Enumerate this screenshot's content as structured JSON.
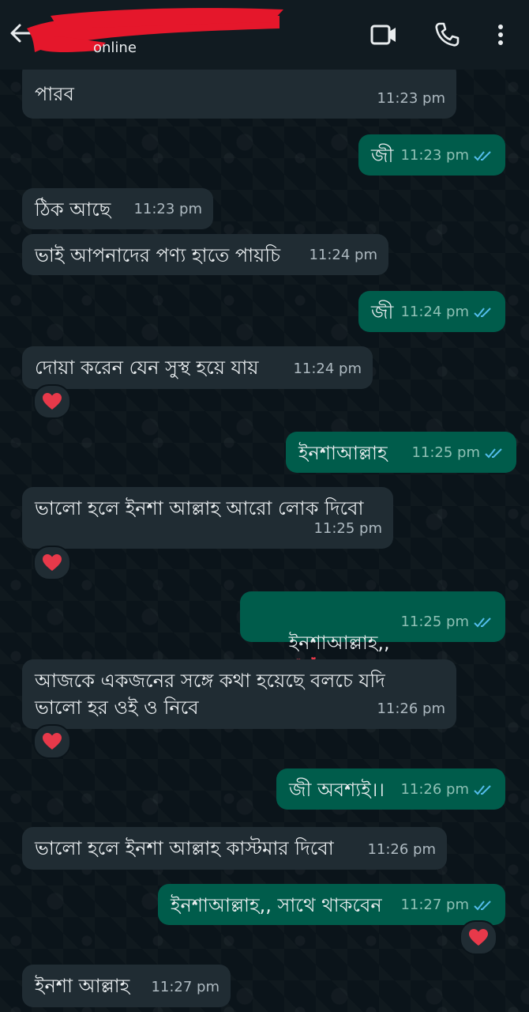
{
  "header": {
    "status": "online"
  },
  "messages": [
    {
      "id": "m0",
      "dir": "in",
      "text": "পারব",
      "time": "11:23 pm"
    },
    {
      "id": "m1",
      "dir": "out",
      "text": "জী",
      "time": "11:23 pm"
    },
    {
      "id": "m2",
      "dir": "in",
      "text": "ঠিক আছে",
      "time": "11:23 pm"
    },
    {
      "id": "m3",
      "dir": "in",
      "text": "ভাই আপনাদের পণ্য হাতে পায়চি",
      "time": "11:24 pm"
    },
    {
      "id": "m4",
      "dir": "out",
      "text": "জী",
      "time": "11:24 pm"
    },
    {
      "id": "m5",
      "dir": "in",
      "text": "দোয়া করেন যেন সুস্থ হয়ে যায়",
      "time": "11:24 pm",
      "reaction": "heart"
    },
    {
      "id": "m6",
      "dir": "out",
      "text": "ইনশাআল্লাহ",
      "time": "11:25 pm"
    },
    {
      "id": "m7",
      "dir": "in",
      "text": "ভালো হলে ইনশা আল্লাহ আরো লোক দিবো",
      "time": "11:25 pm",
      "reaction": "heart"
    },
    {
      "id": "m8",
      "dir": "out",
      "text": "ইনশাআল্লাহ,,",
      "time": "11:25 pm",
      "emoji": "smiling-face-with-hearts"
    },
    {
      "id": "m9",
      "dir": "in",
      "text": "আজকে একজনের সঙ্গে কথা হয়েছে বলচে যদি\nভালো হর ওই ও নিবে",
      "time": "11:26 pm",
      "reaction": "heart"
    },
    {
      "id": "m10",
      "dir": "out",
      "text": "জী অবশ্যই।।",
      "time": "11:26 pm"
    },
    {
      "id": "m11",
      "dir": "in",
      "text": "ভালো হলে ইনশা আল্লাহ কাস্টমার দিবো",
      "time": "11:26 pm"
    },
    {
      "id": "m12",
      "dir": "out",
      "text": "ইনশাআল্লাহ,, সাথে থাকবেন",
      "time": "11:27 pm",
      "reaction": "heart"
    },
    {
      "id": "m13",
      "dir": "in",
      "text": "ইনশা আল্লাহ",
      "time": "11:27 pm"
    }
  ],
  "colors": {
    "incoming": "#202c33",
    "outgoing": "#005c4b",
    "read_ticks": "#53bdeb",
    "heart": "#e8394a"
  }
}
